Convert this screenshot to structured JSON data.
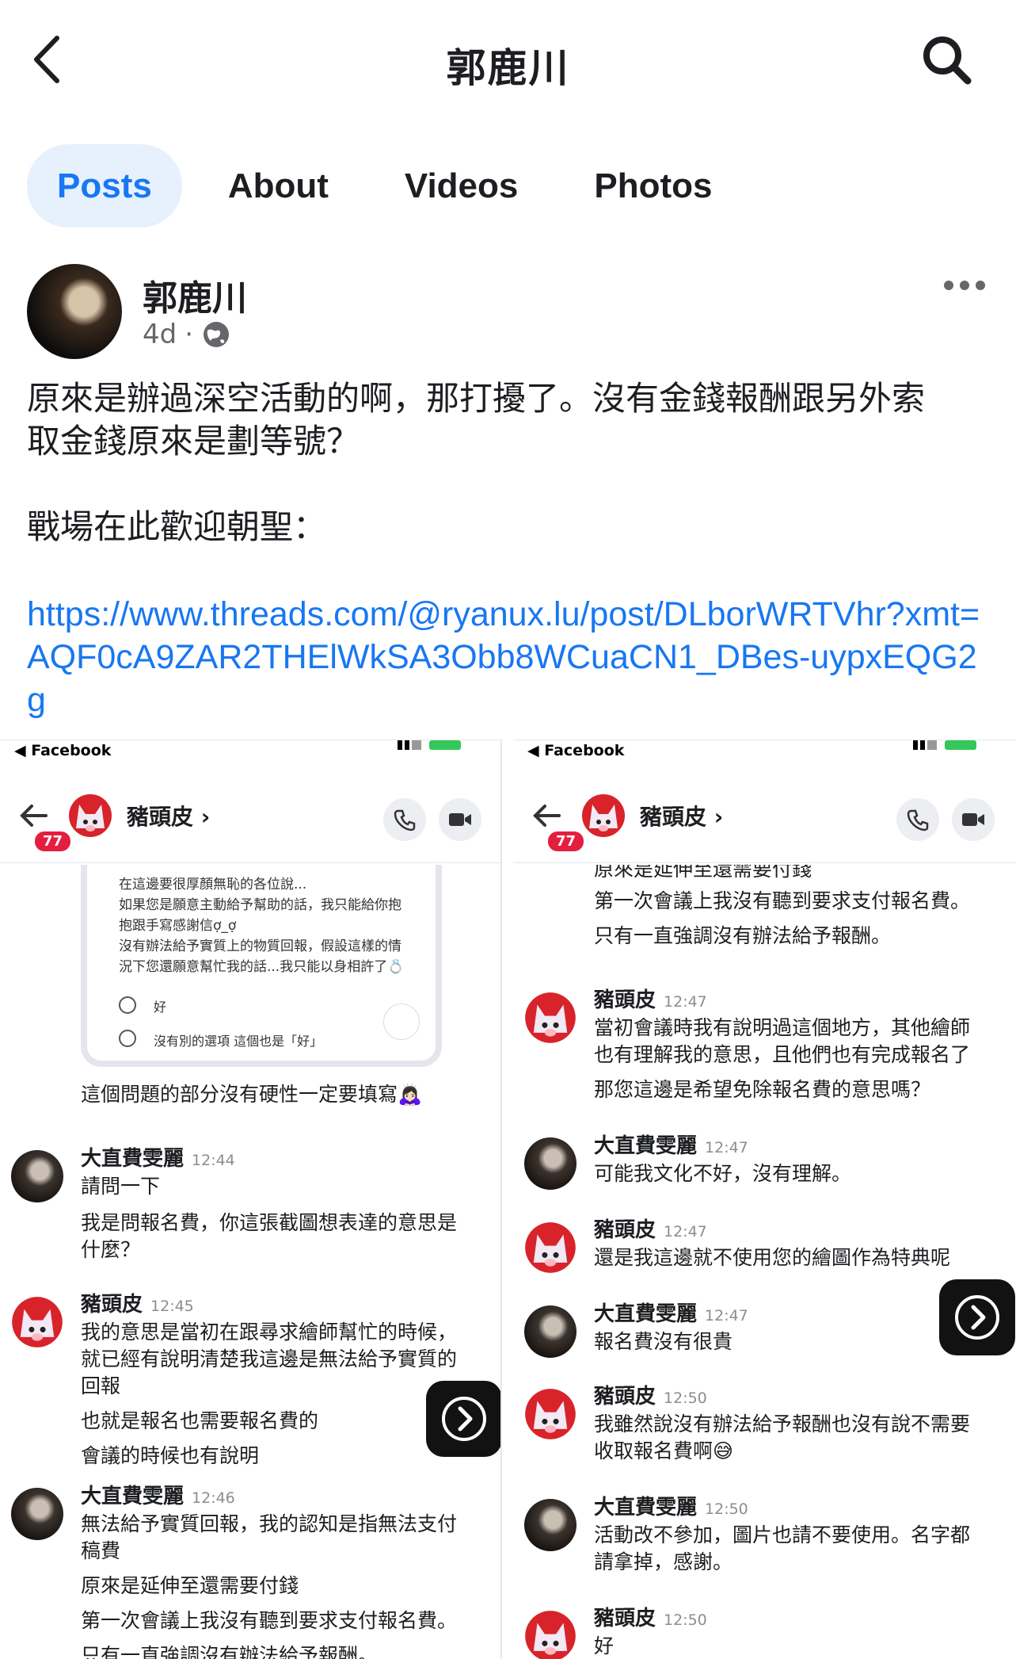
{
  "header": {
    "page_name": "郭鹿川"
  },
  "tabs": [
    {
      "label": "Posts",
      "active": true
    },
    {
      "label": "About"
    },
    {
      "label": "Videos"
    },
    {
      "label": "Photos"
    }
  ],
  "post": {
    "author": "郭鹿川",
    "time": "4d",
    "separator": "·",
    "text_line1": "原來是辦過深空活動的啊，那打擾了。沒有金錢報酬跟另外索",
    "text_line2": "取金錢原來是劃等號？",
    "text_line3": "戰場在此歡迎朝聖：",
    "link": "https://www.threads.com/@ryanux.lu/post/DLborWRTVhr?xmt=AQF0cA9ZAR2THElWkSA3Obb8WCuaCN1_DBes-uypxEQG2g"
  },
  "screenshot_left": {
    "status_app": "◀ Facebook",
    "unread_badge": "77",
    "chat_name": "豬頭皮 ›",
    "form": {
      "line1": "在這邊要很厚顏無恥的各位說...",
      "line2": "如果您是願意主動給予幫助的話，我只能給你抱",
      "line3": "抱跟手寫感謝信ợ_ợ",
      "line4": "沒有辦法給予實質上的物質回報，假設這樣的情",
      "line5": "況下您還願意幫忙我的話...我只能以身相許了💍",
      "opt1": "好",
      "opt2": "沒有別的選項 這個也是「好」"
    },
    "caption": "這個問題的部分沒有硬性一定要填寫🙇🏻‍♀️",
    "messages": [
      {
        "name": "大直費雯麗",
        "time": "12:44",
        "lines": [
          "請問一下",
          "我是問報名費，你這張截圖想表達的意思是",
          "什麼？"
        ]
      },
      {
        "name": "豬頭皮",
        "time": "12:45",
        "lines": [
          "我的意思是當初在跟尋求繪師幫忙的時候，",
          "就已經有說明清楚我這邊是無法給予實質的",
          "回報",
          "也就是報名也需要報名費的",
          "會議的時候也有說明"
        ]
      },
      {
        "name": "大直費雯麗",
        "time": "12:46",
        "lines": [
          "無法給予實質回報，我的認知是指無法支付",
          "稿費",
          "原來是延伸至還需要付錢",
          "第一次會議上我沒有聽到要求支付報名費。",
          "只有一直強調沒有辦法給予報酬。"
        ]
      }
    ]
  },
  "screenshot_right": {
    "status_app": "◀ Facebook",
    "unread_badge": "77",
    "chat_name": "豬頭皮 ›",
    "top_lines": [
      "原來是延伸至還需要付錢",
      "第一次會議上我沒有聽到要求支付報名費。",
      "只有一直強調沒有辦法給予報酬。"
    ],
    "messages": [
      {
        "name": "豬頭皮",
        "time": "12:47",
        "lines": [
          "當初會議時我有說明過這個地方，其他繪師",
          "也有理解我的意思，且他們也有完成報名了",
          "那您這邊是希望免除報名費的意思嗎？"
        ]
      },
      {
        "name": "大直費雯麗",
        "time": "12:47",
        "lines": [
          "可能我文化不好，沒有理解。"
        ]
      },
      {
        "name": "豬頭皮",
        "time": "12:47",
        "lines": [
          "還是我這邊就不使用您的繪圖作為特典呢"
        ]
      },
      {
        "name": "大直費雯麗",
        "time": "12:47",
        "lines": [
          "報名費沒有很貴"
        ]
      },
      {
        "name": "豬頭皮",
        "time": "12:50",
        "lines": [
          "我雖然說沒有辦法給予報酬也沒有說不需要",
          "收取報名費啊😅"
        ]
      },
      {
        "name": "大直費雯麗",
        "time": "12:50",
        "lines": [
          "活動改不參加，圖片也請不要使用。名字都",
          "請拿掉，感謝。"
        ]
      },
      {
        "name": "豬頭皮",
        "time": "12:50",
        "lines": [
          "好"
        ]
      }
    ]
  },
  "colors": {
    "accent": "#1877f2",
    "tab_active_bg": "#e7f0fd",
    "badge": "#e41e3f"
  }
}
